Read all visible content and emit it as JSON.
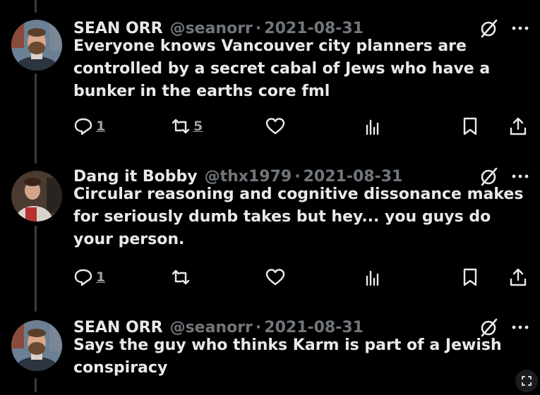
{
  "tweets": [
    {
      "name": "SEAN ORR",
      "handle": "@seanorr",
      "separator": "·",
      "date": "2021-08-31",
      "text": "Everyone knows Vancouver city planners are controlled by a secret cabal of Jews who have a bunker in the earths core fml",
      "replies": "1",
      "reposts": "5",
      "likes": "",
      "avatar": "bearded-man-avatar",
      "icons": [
        "reply-icon",
        "repost-icon",
        "like-icon",
        "views-icon",
        "bookmark-icon",
        "share-icon",
        "grok-icon",
        "more-icon"
      ]
    },
    {
      "name": "Dang it Bobby",
      "handle": "@thx1979",
      "separator": "·",
      "date": "2021-08-31",
      "text": "Circular reasoning and cognitive dissonance makes for seriously dumb takes but hey... you guys do your person.",
      "replies": "1",
      "reposts": "",
      "likes": "",
      "avatar": "person-photo-avatar"
    },
    {
      "name": "SEAN ORR",
      "handle": "@seanorr",
      "separator": "·",
      "date": "2021-08-31",
      "text": "Says the guy who thinks Karm is part of a Jewish conspiracy",
      "avatar": "bearded-man-avatar"
    }
  ],
  "colors": {
    "background": "#000000",
    "text": "#e7e9ea",
    "muted": "#71767b",
    "thread_line": "#3a3d40"
  }
}
